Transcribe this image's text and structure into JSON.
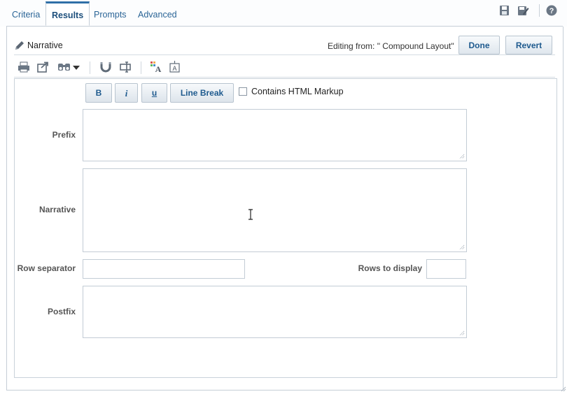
{
  "tabs": [
    "Criteria",
    "Results",
    "Prompts",
    "Advanced"
  ],
  "active_tab": "Results",
  "top_icons": [
    "save-icon",
    "save-as-icon",
    "help-icon"
  ],
  "header": {
    "title": "Narrative",
    "editing_from": "Editing from: \" Compound Layout\"",
    "done_label": "Done",
    "revert_label": "Revert"
  },
  "toolbar_icons": [
    "print-icon",
    "export-icon",
    "binoculars-icon",
    "chevron-down-icon",
    "magnet-icon",
    "rename-view-icon",
    "format-view-icon",
    "edit-text-icon"
  ],
  "format_buttons": {
    "bold": "B",
    "italic": "i",
    "underline": "u",
    "line_break": "Line Break"
  },
  "html_markup_label": "Contains HTML Markup",
  "html_markup_checked": false,
  "fields": {
    "prefix_label": "Prefix",
    "prefix_value": "",
    "narrative_label": "Narrative",
    "narrative_value": "",
    "row_separator_label": "Row separator",
    "row_separator_value": "",
    "rows_to_display_label": "Rows to display",
    "rows_to_display_value": "",
    "postfix_label": "Postfix",
    "postfix_value": ""
  },
  "colors": {
    "accent": "#2f6fa7",
    "link": "#2a6496",
    "border": "#c5ced7"
  }
}
